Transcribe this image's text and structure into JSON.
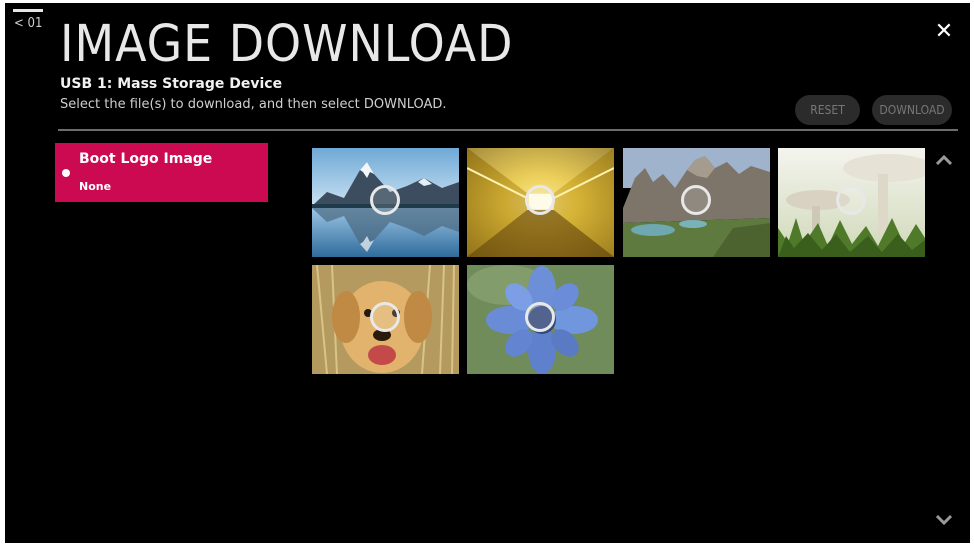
{
  "header": {
    "back_label": "< 01",
    "title": "IMAGE DOWNLOAD",
    "device": "USB 1: Mass Storage Device",
    "instruction": "Select the file(s) to download, and then select DOWNLOAD."
  },
  "actions": {
    "reset_label": "RESET",
    "download_label": "DOWNLOAD"
  },
  "category": {
    "name": "Boot Logo Image",
    "value": "None"
  },
  "thumbnails": [
    {
      "name": "mountain-lake-thumbnail"
    },
    {
      "name": "golden-tunnel-thumbnail"
    },
    {
      "name": "alpine-valley-thumbnail"
    },
    {
      "name": "mushrooms-thumbnail"
    },
    {
      "name": "golden-retriever-thumbnail"
    },
    {
      "name": "blue-flower-thumbnail"
    }
  ],
  "icons": {
    "close": "close-icon",
    "scroll_up": "chevron-up-icon",
    "scroll_down": "chevron-down-icon",
    "select": "select-circle-icon"
  },
  "colors": {
    "accent": "#cc0a51",
    "background": "#000000",
    "button_bg": "#2b2b2b",
    "button_text": "#777777"
  }
}
